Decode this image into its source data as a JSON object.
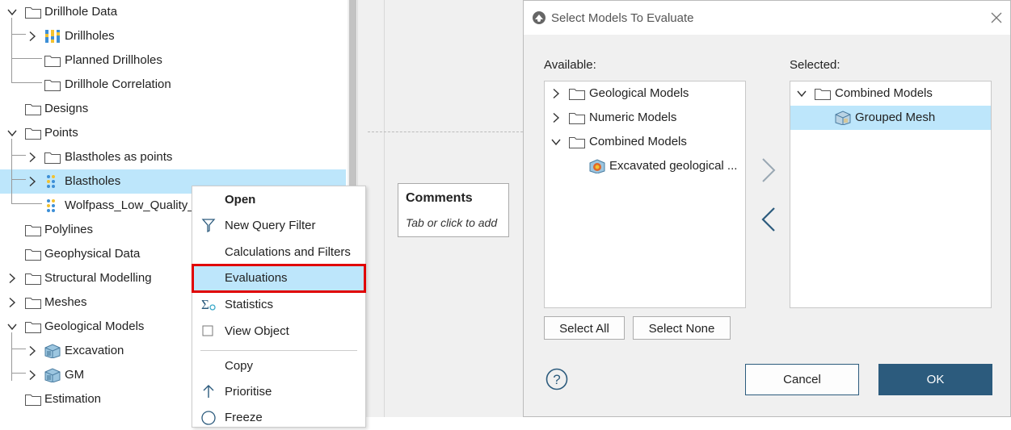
{
  "tree": {
    "items": [
      {
        "label": "Drillhole Data",
        "expander": "down",
        "icon": "folder-icon"
      },
      {
        "label": "Drillholes",
        "expander": "right",
        "icon": "drillholes-icon"
      },
      {
        "label": "Planned Drillholes",
        "expander": "none",
        "icon": "folder-icon"
      },
      {
        "label": "Drillhole Correlation",
        "expander": "none",
        "icon": "folder-icon"
      },
      {
        "label": "Designs",
        "expander": "none",
        "icon": "folder-icon"
      },
      {
        "label": "Points",
        "expander": "down",
        "icon": "folder-icon"
      },
      {
        "label": "Blastholes as points",
        "expander": "right",
        "icon": "folder-icon"
      },
      {
        "label": "Blastholes",
        "expander": "right",
        "icon": "points-icon",
        "selected": true
      },
      {
        "label": "Wolfpass_Low_Quality_",
        "expander": "none",
        "icon": "points-icon"
      },
      {
        "label": "Polylines",
        "expander": "none",
        "icon": "folder-icon"
      },
      {
        "label": "Geophysical Data",
        "expander": "none",
        "icon": "folder-icon"
      },
      {
        "label": "Structural Modelling",
        "expander": "right",
        "icon": "folder-icon"
      },
      {
        "label": "Meshes",
        "expander": "right",
        "icon": "folder-icon"
      },
      {
        "label": "Geological Models",
        "expander": "down",
        "icon": "folder-icon"
      },
      {
        "label": "Excavation",
        "expander": "right",
        "icon": "geomodel-icon"
      },
      {
        "label": "GM",
        "expander": "right",
        "icon": "geomodel-icon"
      },
      {
        "label": "Estimation",
        "expander": "none",
        "icon": "folder-icon"
      }
    ]
  },
  "comments": {
    "title": "Comments",
    "hint": "Tab or click to add"
  },
  "context_menu": {
    "items": [
      {
        "label": "Open",
        "bold": true,
        "icon": ""
      },
      {
        "label": "New Query Filter",
        "icon": "filter-icon"
      },
      {
        "label": "Calculations and Filters",
        "icon": ""
      },
      {
        "label": "Evaluations",
        "icon": "",
        "highlighted": true
      },
      {
        "label": "Statistics",
        "icon": "statistics-icon"
      },
      {
        "label": "View Object",
        "icon": "checkbox-icon"
      },
      {
        "label": "Copy",
        "icon": ""
      },
      {
        "label": "Prioritise",
        "icon": "arrow-up-icon"
      },
      {
        "label": "Freeze",
        "icon": "freeze-icon"
      }
    ]
  },
  "dialog": {
    "title": "Select Models To Evaluate",
    "available_label": "Available:",
    "selected_label": "Selected:",
    "available_items": [
      {
        "label": "Geological Models",
        "expander": "right",
        "icon": "folder-icon"
      },
      {
        "label": "Numeric Models",
        "expander": "right",
        "icon": "folder-icon"
      },
      {
        "label": "Combined Models",
        "expander": "down",
        "icon": "folder-icon"
      },
      {
        "label": "Excavated geological ...",
        "expander": "none",
        "icon": "excavated-model-icon"
      }
    ],
    "selected_items": [
      {
        "label": "Combined Models",
        "expander": "down",
        "icon": "folder-icon"
      },
      {
        "label": "Grouped Mesh",
        "expander": "none",
        "icon": "grouped-mesh-icon",
        "selected": true
      }
    ],
    "select_all": "Select All",
    "select_none": "Select None",
    "cancel": "Cancel",
    "ok": "OK",
    "colors": {
      "accent": "#2c5b7d",
      "selection": "#bde6fb",
      "highlight_border": "#e00000"
    }
  }
}
